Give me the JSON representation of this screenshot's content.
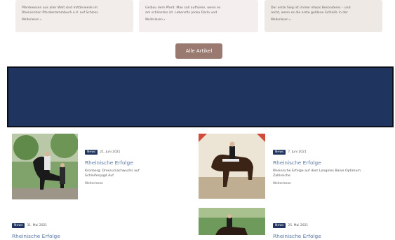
{
  "top_cards": [
    {
      "text_lines": [
        "Pferdeexsen aus aller Welt sind mittlerweile im",
        "Rheinischen Pferdestammbuch e.V. auf Schloss"
      ],
      "more": "Weiterlesen »"
    },
    {
      "text_lines": [
        "Gelbau dem Pferd: Man soll aufhören, wenn es",
        "am schönsten ist. Lebensfin Jenka Darlo und"
      ],
      "more": "Weiterlesen »"
    },
    {
      "text_lines": [
        "Der erste Sieg ist immer etwas Besonderes – und",
        "recht, wenn es die erste goldene Schleife in der"
      ],
      "more": "Weiterlesen »"
    }
  ],
  "all_articles_button": "Alle Artikel",
  "posts": [
    {
      "badge": "News",
      "date": "21. Juni 2021",
      "title": "Rheinische Erfolge",
      "excerpt_lines": [
        "Kronberg: Dressurnachwuchs auf",
        "Schleifenjagd Auf"
      ],
      "more": "Weiterlesen"
    },
    {
      "badge": "News",
      "date": "7. Juni 2021",
      "title": "Rheinische Erfolge",
      "excerpt_lines": [
        "Rheinische Erfolge auf dem Longines Balve Optimum",
        "Zahlreiche"
      ],
      "more": "Weiterlesen"
    },
    {
      "badge": "News",
      "date": "31. Mai 2021",
      "title": "Rheinische Erfolge"
    },
    {
      "badge": "News",
      "date": "25. Mai 2021",
      "title": "Rheinische Erfolge"
    }
  ],
  "colors": {
    "banner": "#1f3560",
    "button": "#9a7a70",
    "badge": "#1f3560",
    "title_link": "#5a77a3"
  }
}
